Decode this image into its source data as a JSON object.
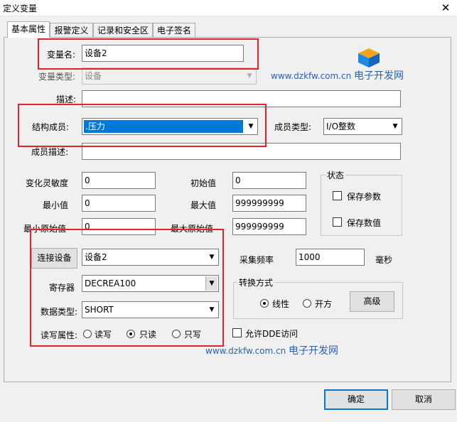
{
  "window": {
    "title": "定义变量"
  },
  "tabs": [
    "基本属性",
    "报警定义",
    "记录和安全区",
    "电子签名"
  ],
  "form": {
    "var_name_label": "变量名:",
    "var_name_value": "设备2",
    "var_type_label": "变量类型:",
    "var_type_value": "设备",
    "desc_label": "描述:",
    "desc_value": "",
    "struct_member_label": "结构成员:",
    "struct_member_value": ".压力",
    "member_type_label": "成员类型:",
    "member_type_value": "I/O整数",
    "member_desc_label": "成员描述:",
    "member_desc_value": "",
    "sensitivity_label": "变化灵敏度",
    "sensitivity_value": "0",
    "init_label": "初始值",
    "init_value": "0",
    "min_label": "最小值",
    "min_value": "0",
    "max_label": "最大值",
    "max_value": "999999999",
    "min_raw_label": "最小原始值",
    "min_raw_value": "0",
    "max_raw_label": "最大原始值",
    "max_raw_value": "999999999"
  },
  "status_group": {
    "title": "状态",
    "save_params": "保存参数",
    "save_values": "保存数值"
  },
  "device": {
    "connect_button": "连接设备",
    "device_value": "设备2",
    "register_label": "寄存器",
    "register_value": "DECREA100",
    "data_type_label": "数据类型:",
    "data_type_value": "SHORT",
    "rw_label": "读写属性:",
    "rw_options": [
      "读写",
      "只读",
      "只写"
    ],
    "rw_selected": "只读"
  },
  "sampling": {
    "label": "采集频率",
    "value": "1000",
    "unit": "毫秒"
  },
  "conversion": {
    "title": "转换方式",
    "options": [
      "线性",
      "开方"
    ],
    "selected": "线性",
    "advanced_button": "高级"
  },
  "dde": {
    "label": "允许DDE访问"
  },
  "watermark": {
    "url": "www.dzkfw.com.cn",
    "name": "电子开发网"
  },
  "footer": {
    "ok_button": "确定",
    "cancel_button": "取消"
  },
  "colors": {
    "highlight_red": "#e0262b",
    "selection_blue": "#0078d7",
    "watermark_blue": "#2a5fb8"
  }
}
